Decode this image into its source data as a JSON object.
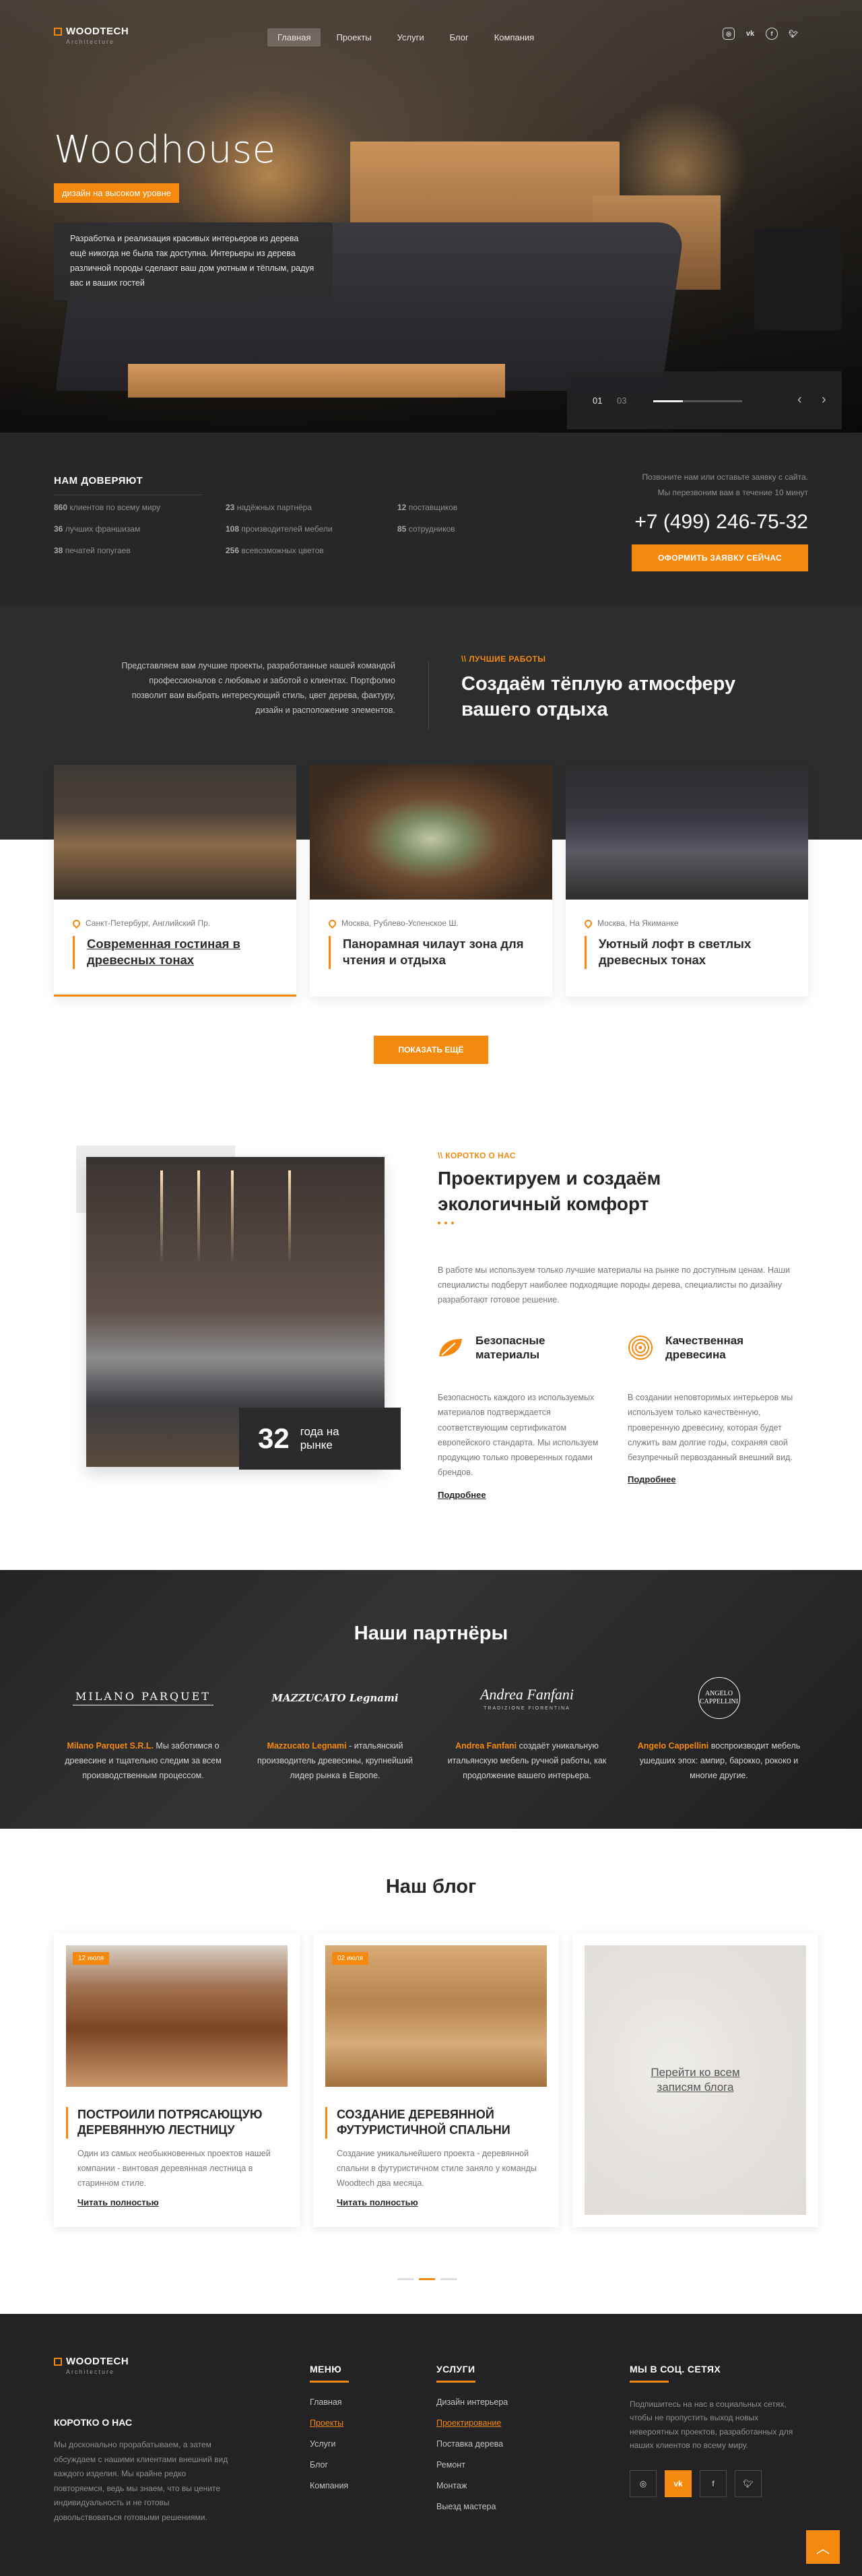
{
  "brand": {
    "name": "WOODTECH",
    "sub": "Architecture"
  },
  "nav": {
    "items": [
      "Главная",
      "Проекты",
      "Услуги",
      "Блог",
      "Компания"
    ],
    "active": 0
  },
  "socials": [
    "instagram-icon",
    "vk-icon",
    "facebook-icon",
    "twitter-icon"
  ],
  "hero": {
    "title": "Woodhouse",
    "badge": "дизайн на высоком уровне",
    "text": "Разработка и реализация красивых интерьеров из дерева ещё никогда не была так доступна. Интерьеры из дерева различной породы сделают ваш дом уютным и тёплым, радуя вас и ваших гостей",
    "slider": {
      "current": "01",
      "total": "03",
      "progress": 0.33
    }
  },
  "trust": {
    "title": "НАМ ДОВЕРЯЮТ",
    "stats": [
      {
        "num": "860",
        "text": "клиентов по всему миру"
      },
      {
        "num": "23",
        "text": "надёжных партнёра"
      },
      {
        "num": "12",
        "text": "поставщиков"
      },
      {
        "num": "36",
        "text": "лучших франшизам"
      },
      {
        "num": "108",
        "text": "производителей мебели"
      },
      {
        "num": "85",
        "text": "сотрудников"
      },
      {
        "num": "38",
        "text": "печатей попугаев"
      },
      {
        "num": "256",
        "text": "всевозможных цветов"
      }
    ],
    "note_line1": "Позвоните нам или оставьте заявку с сайта.",
    "note_line2": "Мы перезвоним вам в течение 10 минут",
    "phone": "+7 (499) 246-75-32",
    "cta": "ОФОРМИТЬ ЗАЯВКУ СЕЙЧАС"
  },
  "works": {
    "intro": "Представляем вам лучшие проекты, разработанные нашей командой профессионалов с любовью и заботой о клиентах. Портфолио позволит вам выбрать интересующий стиль, цвет дерева, фактуру, дизайн и расположение элементов.",
    "eyebrow": "\\\\ ЛУЧШИЕ РАБОТЫ",
    "title": "Создаём тёплую атмосферу вашего отдыха",
    "cards": [
      {
        "location": "Санкт-Петербург, Английский Пр.",
        "title": "Современная гостиная в древесных тонах"
      },
      {
        "location": "Москва, Рублево-Успенское Ш.",
        "title": "Панорамная чилаут зона для чтения и отдыха"
      },
      {
        "location": "Москва, На Якиманке",
        "title": "Уютный лофт в светлых древесных тонах"
      }
    ],
    "more": "ПОКАЗАТЬ ЕЩЁ"
  },
  "about": {
    "eyebrow": "\\\\ КОРОТКО О НАС",
    "title": "Проектируем и создаём экологичный комфорт",
    "intro": "В работе мы используем только лучшие материалы на рынке по доступным ценам. Наши специалисты подберут наиболее подходящие породы дерева, специалисты по дизайну разработают готовое решение.",
    "years_num": "32",
    "years_label": "года на рынке",
    "features": [
      {
        "name": "Безопасные материалы",
        "desc": "Безопасность каждого из используемых материалов подтверждается соответствующим сертификатом европейского стандарта. Мы используем продукцию только проверенных годами брендов.",
        "link": "Подробнее"
      },
      {
        "name": "Качественная древесина",
        "desc": "В создании неповторимых интерьеров мы используем только качественную, проверенную древесину, которая будет служить вам долгие годы, сохраняя свой безупречный первозданный внешний вид.",
        "link": "Подробнее"
      }
    ]
  },
  "partners": {
    "title": "Наши партнёры",
    "list": [
      {
        "logo": "MILANO PARQUET",
        "name": "Milano Parquet S.R.L.",
        "text": " Мы заботимся о древесине и тщательно следим за всем производственным процессом."
      },
      {
        "logo": "MAZZUCATO Legnami",
        "name": "Mazzucato Legnami",
        "text": " - итальянский производитель древесины, крупнейший лидер рынка в Европе."
      },
      {
        "logo": "Andrea Fanfani",
        "logo_sub": "TRADIZIONE FIORENTINA",
        "name": "Andrea Fanfani",
        "text": " создаёт уникальную итальянскую мебель ручной работы, как продолжение вашего интерьера."
      },
      {
        "logo": "ANGELO CAPPELLINI",
        "name": "Angelo Cappellini",
        "text": " воспроизводит мебель ушедших эпох: ампир, барокко, рококо и многие другие."
      }
    ]
  },
  "blog": {
    "title": "Наш блог",
    "posts": [
      {
        "date": "12 июля",
        "title": "ПОСТРОИЛИ ПОТРЯСАЮЩУЮ ДЕРЕВЯННУЮ ЛЕСТНИЦУ",
        "desc": "Один из самых необыкновенных проектов нашей компании - винтовая деревянная лестница в старинном стиле.",
        "link": "Читать полностью"
      },
      {
        "date": "02 июля",
        "title": "СОЗДАНИЕ ДЕРЕВЯННОЙ ФУТУРИСТИЧНОЙ СПАЛЬНИ",
        "desc": "Создание уникальнейшего проекта - деревянной спальни в футуристичном стиле заняло у команды Woodtech два месяца.",
        "link": "Читать полностью"
      }
    ],
    "all_link": "Перейти ко всем записям блога"
  },
  "footer": {
    "about_title": "КОРОТКО О НАС",
    "about_text": "Мы досконально прорабатываем, а затем обсуждаем с нашими клиентами внешний вид каждого изделия. Мы крайне редко повторяемся, ведь мы знаем, что вы цените индивидуальность и не готовы довольствоваться готовыми решениями.",
    "menu_title": "МЕНЮ",
    "menu": [
      "Главная",
      "Проекты",
      "Услуги",
      "Блог",
      "Компания"
    ],
    "menu_selected": 1,
    "services_title": "УСЛУГИ",
    "services": [
      "Дизайн интерьера",
      "Проектирование",
      "Поставка дерева",
      "Ремонт",
      "Монтаж",
      "Выезд мастера"
    ],
    "services_selected": 1,
    "social_title": "МЫ В СОЦ. СЕТЯХ",
    "social_text": "Подпишитесь на нас в социальных сетях, чтобы не пропустить выход новых невероятных проектов, разработанных для наших клиентов по всему миру.",
    "accent": "#f5890e"
  }
}
